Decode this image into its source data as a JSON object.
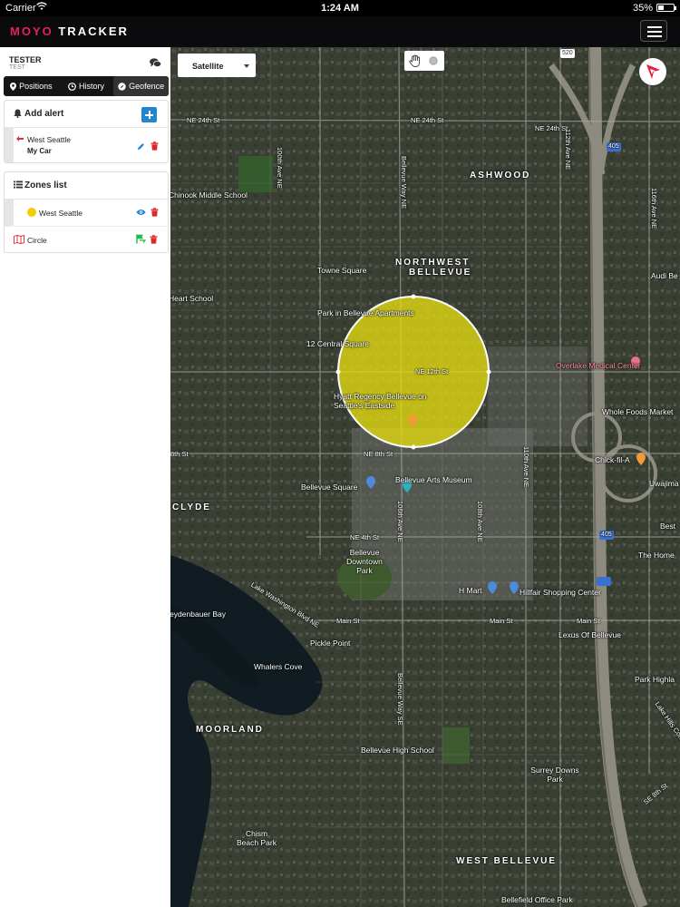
{
  "status_bar": {
    "carrier": "Carrier",
    "time": "1:24 AM",
    "battery": "35%",
    "battery_level": 0.35
  },
  "app": {
    "logo_a": "MOYO",
    "logo_b": "TRACKER"
  },
  "user": {
    "name": "TESTER",
    "sub": "TEST"
  },
  "tabs": [
    {
      "label": "Positions",
      "icon": "map-marker-icon"
    },
    {
      "label": "History",
      "icon": "clock-icon"
    },
    {
      "label": "Geofence",
      "icon": "compass-icon"
    }
  ],
  "alerts": {
    "title": "Add alert",
    "items": [
      {
        "zone": "West Seattle",
        "vehicle": "My Car"
      }
    ]
  },
  "zones": {
    "title": "Zones list",
    "items": [
      {
        "name": "West Seattle",
        "color": "#f2d000"
      }
    ],
    "shape_label": "Circle"
  },
  "map": {
    "layer": "Satellite",
    "route_badges": [
      "520",
      "405",
      "405"
    ],
    "areas": [
      "ASHWOOD",
      "NORTHWEST",
      "BELLEVUE",
      "CLYDE",
      "MOORLAND",
      "WEST BELLEVUE"
    ],
    "roads": [
      "NE 24th St",
      "NE 24th St",
      "NE 24th St",
      "100th Ave NE",
      "Bellevue Way NE",
      "112th Ave NE",
      "116th Ave NE",
      "NE 12th St",
      "NE 8th St",
      "8th St",
      "NE 4th St",
      "Main St",
      "Main St",
      "Lake Washington Blvd NE",
      "110th Ave NE",
      "106th Ave NE",
      "108th Ave NE",
      "SE 8th St",
      "Bellevue Way SE",
      "Lake Hills Connector",
      "Main St"
    ],
    "places": [
      "Chinook Middle School",
      "Towne Square",
      "Heart School",
      "Park in Bellevue Apartments",
      "12 Central Square",
      "Hyatt Regency Bellevue on Seattle's Eastside",
      "Overlake Medical Center",
      "Whole Foods Market",
      "Chick-fil-A",
      "Uwajima",
      "Bellevue Square",
      "Bellevue Arts Museum",
      "Bellevue Downtown Park",
      "H Mart",
      "Hillfair Shopping Center",
      "The Home",
      "Best",
      "Pickle Point",
      "Whalers Cove",
      "Meydenbauer Bay",
      "Lexus Of Bellevue",
      "Park Highla",
      "Bellevue High School",
      "Surrey Downs Park",
      "Chism Beach Park",
      "Bellefield Office Park",
      "Audi Be"
    ]
  }
}
